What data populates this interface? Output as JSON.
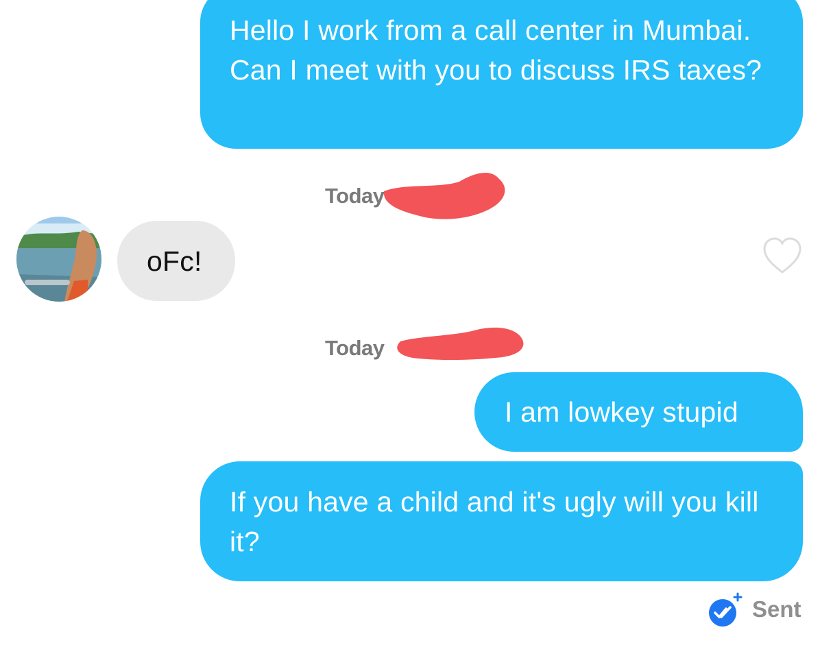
{
  "conversation": {
    "messages": [
      {
        "direction": "outgoing",
        "text": "Hello I work from a call center in Mumbai. Can I meet with you to discuss IRS taxes?"
      },
      {
        "direction": "incoming",
        "text": "oFc!"
      },
      {
        "direction": "outgoing",
        "text": "I am lowkey stupid"
      },
      {
        "direction": "outgoing",
        "text": "If you have a child and it's ugly will you kill it?"
      }
    ],
    "timestamps": [
      "Today",
      "Today"
    ],
    "status": "Sent"
  },
  "icons": {
    "like": "heart-outline-icon",
    "status": "sent-check-icon"
  },
  "colors": {
    "outgoing_bubble": "#26bdf8",
    "incoming_bubble": "#e9e9ea",
    "redaction": "#f25457",
    "status_icon": "#1f78f2"
  }
}
